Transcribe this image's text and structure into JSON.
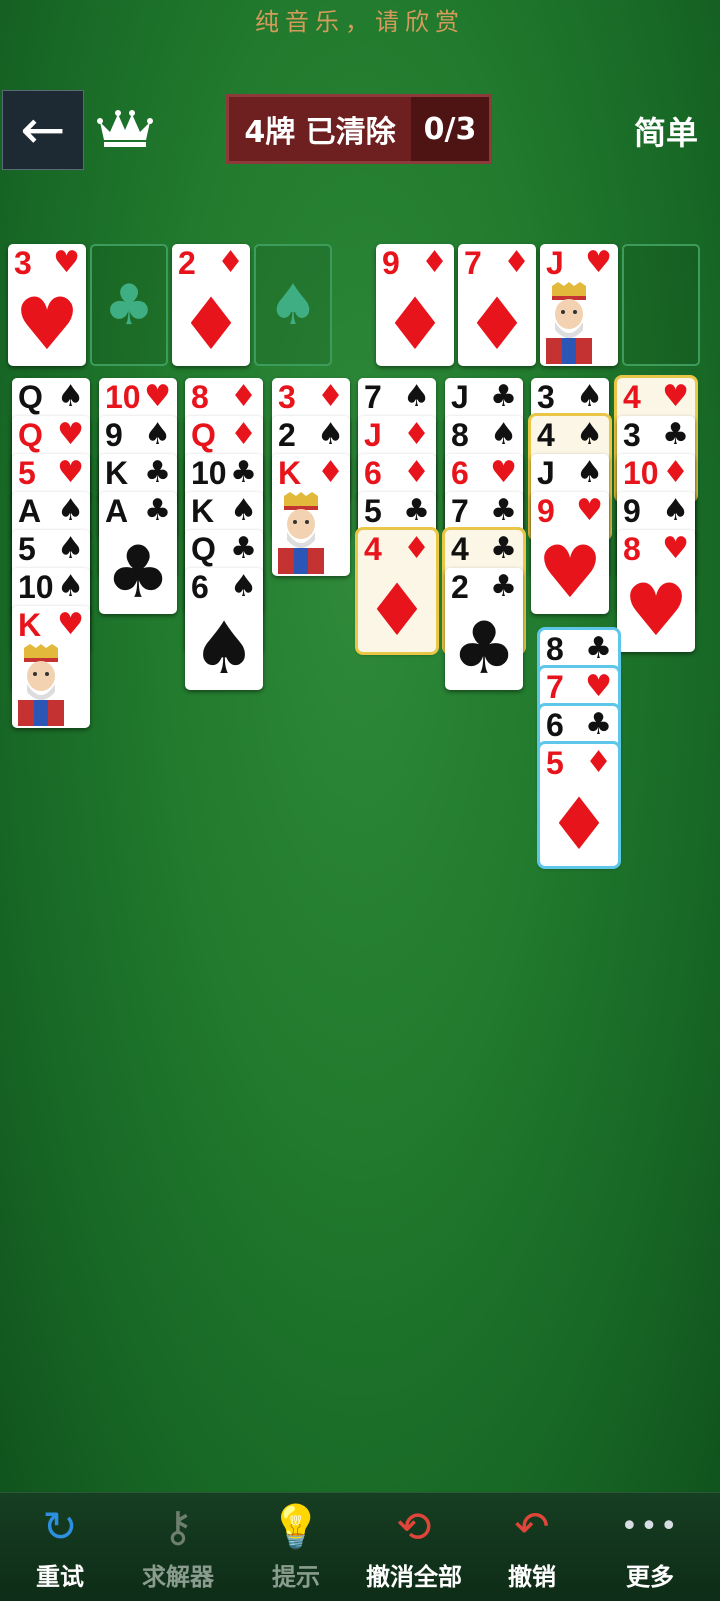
{
  "banner": "纯音乐，请欣赏",
  "header": {
    "back_icon": "←",
    "crown_icon": "crown-icon",
    "counter_label": "4牌 已清除",
    "counter_value": "0/3",
    "difficulty": "简单"
  },
  "free_cells": [
    {
      "rank": "3",
      "suit": "♥",
      "color": "red"
    },
    {
      "empty_symbol": "♣"
    },
    {
      "rank": "2",
      "suit": "♦",
      "color": "red"
    },
    {
      "empty_symbol": "♠"
    }
  ],
  "foundations": [
    {
      "rank": "9",
      "suit": "♦",
      "color": "red"
    },
    {
      "rank": "7",
      "suit": "♦",
      "color": "red"
    },
    {
      "rank": "J",
      "suit": "♥",
      "color": "red",
      "face": true
    },
    {
      "empty": true
    }
  ],
  "tableau": [
    [
      {
        "rank": "Q",
        "suit": "♠",
        "color": "black"
      },
      {
        "rank": "Q",
        "suit": "♥",
        "color": "red"
      },
      {
        "rank": "5",
        "suit": "♥",
        "color": "red"
      },
      {
        "rank": "A",
        "suit": "♠",
        "color": "black"
      },
      {
        "rank": "5",
        "suit": "♠",
        "color": "black"
      },
      {
        "rank": "10",
        "suit": "♠",
        "color": "black"
      },
      {
        "rank": "K",
        "suit": "♥",
        "color": "red",
        "face": true
      }
    ],
    [
      {
        "rank": "10",
        "suit": "♥",
        "color": "red"
      },
      {
        "rank": "9",
        "suit": "♠",
        "color": "black"
      },
      {
        "rank": "K",
        "suit": "♣",
        "color": "black"
      },
      {
        "rank": "A",
        "suit": "♣",
        "color": "black"
      }
    ],
    [
      {
        "rank": "8",
        "suit": "♦",
        "color": "red"
      },
      {
        "rank": "Q",
        "suit": "♦",
        "color": "red"
      },
      {
        "rank": "10",
        "suit": "♣",
        "color": "black"
      },
      {
        "rank": "K",
        "suit": "♠",
        "color": "black"
      },
      {
        "rank": "Q",
        "suit": "♣",
        "color": "black"
      },
      {
        "rank": "6",
        "suit": "♠",
        "color": "black"
      }
    ],
    [
      {
        "rank": "3",
        "suit": "♦",
        "color": "red"
      },
      {
        "rank": "2",
        "suit": "♠",
        "color": "black"
      },
      {
        "rank": "K",
        "suit": "♦",
        "color": "red",
        "face": true
      }
    ],
    [
      {
        "rank": "7",
        "suit": "♠",
        "color": "black"
      },
      {
        "rank": "J",
        "suit": "♦",
        "color": "red"
      },
      {
        "rank": "6",
        "suit": "♦",
        "color": "red"
      },
      {
        "rank": "5",
        "suit": "♣",
        "color": "black"
      },
      {
        "rank": "4",
        "suit": "♦",
        "color": "red",
        "highlight": "yellow"
      }
    ],
    [
      {
        "rank": "J",
        "suit": "♣",
        "color": "black"
      },
      {
        "rank": "8",
        "suit": "♠",
        "color": "black"
      },
      {
        "rank": "6",
        "suit": "♥",
        "color": "red"
      },
      {
        "rank": "7",
        "suit": "♣",
        "color": "black"
      },
      {
        "rank": "4",
        "suit": "♣",
        "color": "black",
        "highlight": "yellow"
      },
      {
        "rank": "2",
        "suit": "♣",
        "color": "black"
      }
    ],
    [
      {
        "rank": "3",
        "suit": "♠",
        "color": "black"
      },
      {
        "rank": "4",
        "suit": "♠",
        "color": "black",
        "highlight": "yellow"
      },
      {
        "rank": "J",
        "suit": "♠",
        "color": "black"
      },
      {
        "rank": "9",
        "suit": "♥",
        "color": "red"
      }
    ],
    [
      {
        "rank": "4",
        "suit": "♥",
        "color": "red",
        "highlight": "yellow"
      },
      {
        "rank": "3",
        "suit": "♣",
        "color": "black"
      },
      {
        "rank": "10",
        "suit": "♦",
        "color": "red"
      },
      {
        "rank": "9",
        "suit": "♠",
        "color": "black"
      },
      {
        "rank": "8",
        "suit": "♥",
        "color": "red"
      }
    ]
  ],
  "drag_stack": [
    {
      "rank": "8",
      "suit": "♣",
      "color": "black"
    },
    {
      "rank": "7",
      "suit": "♥",
      "color": "red"
    },
    {
      "rank": "6",
      "suit": "♣",
      "color": "black"
    },
    {
      "rank": "5",
      "suit": "♦",
      "color": "red"
    }
  ],
  "toolbar": [
    {
      "label": "重试",
      "icon": "↻",
      "icon_name": "retry-icon",
      "color": "#2d8fe0",
      "enabled": true
    },
    {
      "label": "求解器",
      "icon": "⚷",
      "icon_name": "key-icon",
      "color": "#6f7f6f",
      "enabled": false
    },
    {
      "label": "提示",
      "icon": "💡",
      "icon_name": "lightbulb-icon",
      "color": "#6f7f6f",
      "enabled": false
    },
    {
      "label": "撤消全部",
      "icon": "⟲",
      "icon_name": "undo-all-icon",
      "color": "#e0453a",
      "enabled": true
    },
    {
      "label": "撤销",
      "icon": "↶",
      "icon_name": "undo-icon",
      "color": "#e0453a",
      "enabled": true
    },
    {
      "label": "更多",
      "icon": "•••",
      "icon_name": "more-icon",
      "color": "#d7dde3",
      "enabled": true
    }
  ]
}
